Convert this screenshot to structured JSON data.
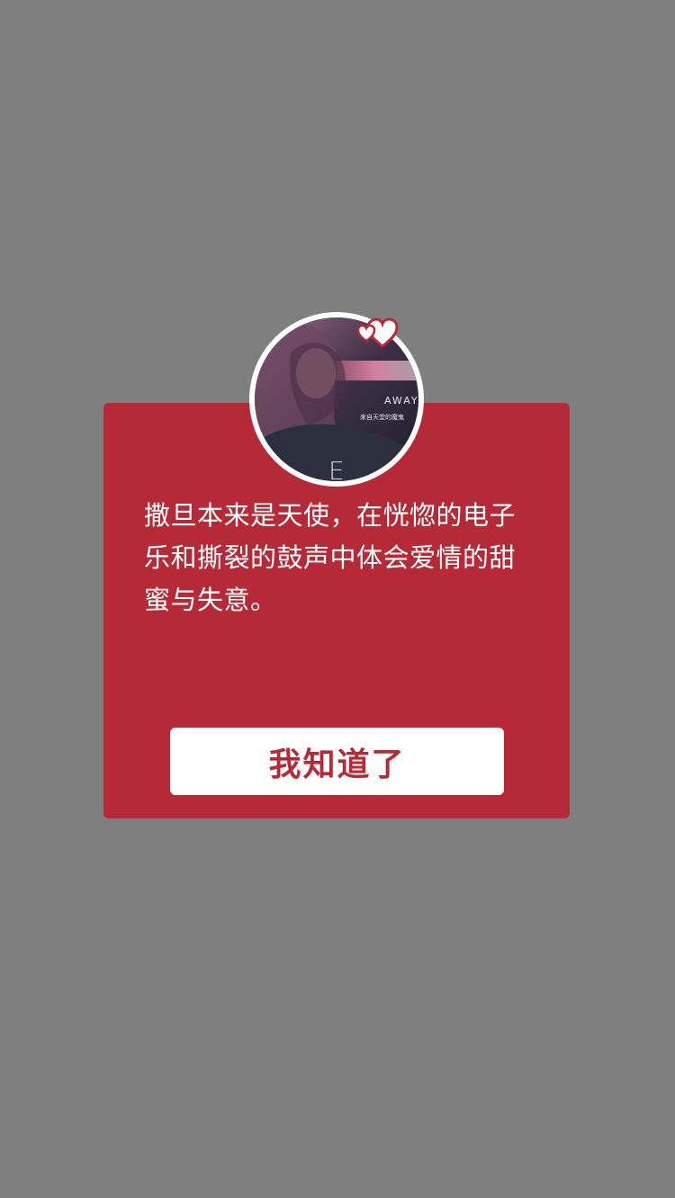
{
  "dialog": {
    "message": "撒旦本来是天使，在恍惚的电子乐和撕裂的鼓声中体会爱情的甜蜜与失意。",
    "button_label": "我知道了"
  },
  "avatar": {
    "cover_title": "AWAY",
    "cover_subtitle": "来自天堂的魔鬼",
    "cover_letter": "E"
  },
  "colors": {
    "overlay": "#7f7f7f",
    "dialog_bg": "#b52a36",
    "button_bg": "#ffffff",
    "button_text": "#b52a36",
    "message_text": "#ffffff"
  },
  "icons": {
    "badge": "hearts-icon"
  }
}
